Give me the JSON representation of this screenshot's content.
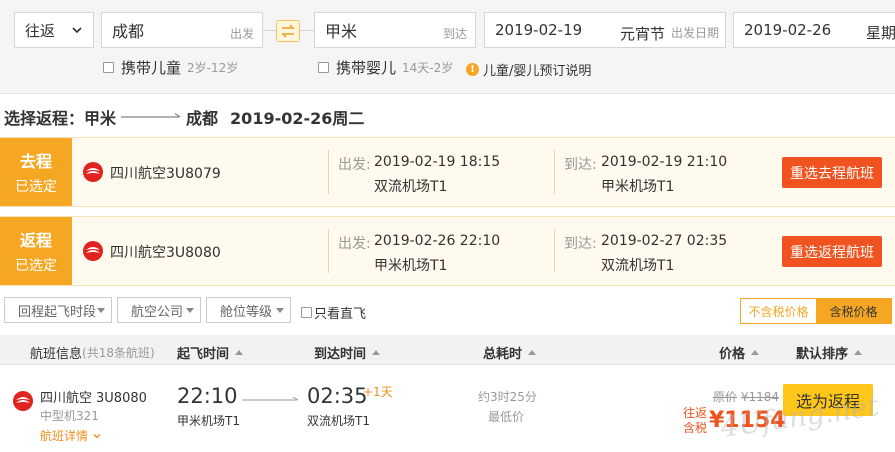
{
  "search": {
    "trip_type": "往返",
    "from_city": "成都",
    "from_hint": "出发",
    "to_city": "甲米",
    "to_hint": "到达",
    "depart_date": "2019-02-19",
    "depart_holiday": "元宵节",
    "depart_hint": "出发日期",
    "return_date": "2019-02-26",
    "return_weekday": "星期",
    "child_label": "携带儿童",
    "child_age": "2岁-12岁",
    "infant_label": "携带婴儿",
    "infant_age": "14天-2岁",
    "child_note": "儿童/婴儿预订说明"
  },
  "title": {
    "prefix": "选择返程：",
    "from": "甲米",
    "to": "成都",
    "date": "2019-02-26周二"
  },
  "selected": {
    "outbound": {
      "tag1": "去程",
      "tag2": "已选定",
      "airline": "四川航空3U8079",
      "dep_label": "出发:",
      "dep_time": "2019-02-19 18:15",
      "dep_port": "双流机场T1",
      "arr_label": "到达:",
      "arr_time": "2019-02-19 21:10",
      "arr_port": "甲米机场T1",
      "button": "重选去程航班"
    },
    "return": {
      "tag1": "返程",
      "tag2": "已选定",
      "airline": "四川航空3U8080",
      "dep_label": "出发:",
      "dep_time": "2019-02-26 22:10",
      "dep_port": "甲米机场T1",
      "arr_label": "到达:",
      "arr_time": "2019-02-27 02:35",
      "arr_port": "双流机场T1",
      "button": "重选返程航班"
    }
  },
  "filters": {
    "time": "回程起飞时段",
    "airline": "航空公司",
    "cabin": "舱位等级",
    "direct": "只看直飞",
    "tax_off": "不含税价格",
    "tax_on": "含税价格"
  },
  "table": {
    "col_flight": "航班信息",
    "col_flight_count": "(共18条航班)",
    "col_dep": "起飞时间",
    "col_arr": "到达时间",
    "col_dur": "总耗时",
    "col_price": "价格",
    "col_sort": "默认排序"
  },
  "row": {
    "airline": "四川航空",
    "code": "3U8080",
    "plane": "中型机321",
    "detail": "航班详情",
    "dep_time": "22:10",
    "dep_port": "甲米机场T1",
    "arr_time": "02:35",
    "next_day": "+1天",
    "arr_port": "双流机场T1",
    "duration": "约3时25分",
    "lowest": "最低价",
    "orig_label": "原价",
    "orig_price": "¥1184",
    "price_tag1": "往返",
    "price_tag2": "含税",
    "price": "¥1154",
    "button": "选为返程"
  },
  "watermark": "4Ufang.net",
  "colors": {
    "accent_orange": "#f5a623",
    "button_red": "#f0531f",
    "select_yellow": "#ffc71a"
  }
}
